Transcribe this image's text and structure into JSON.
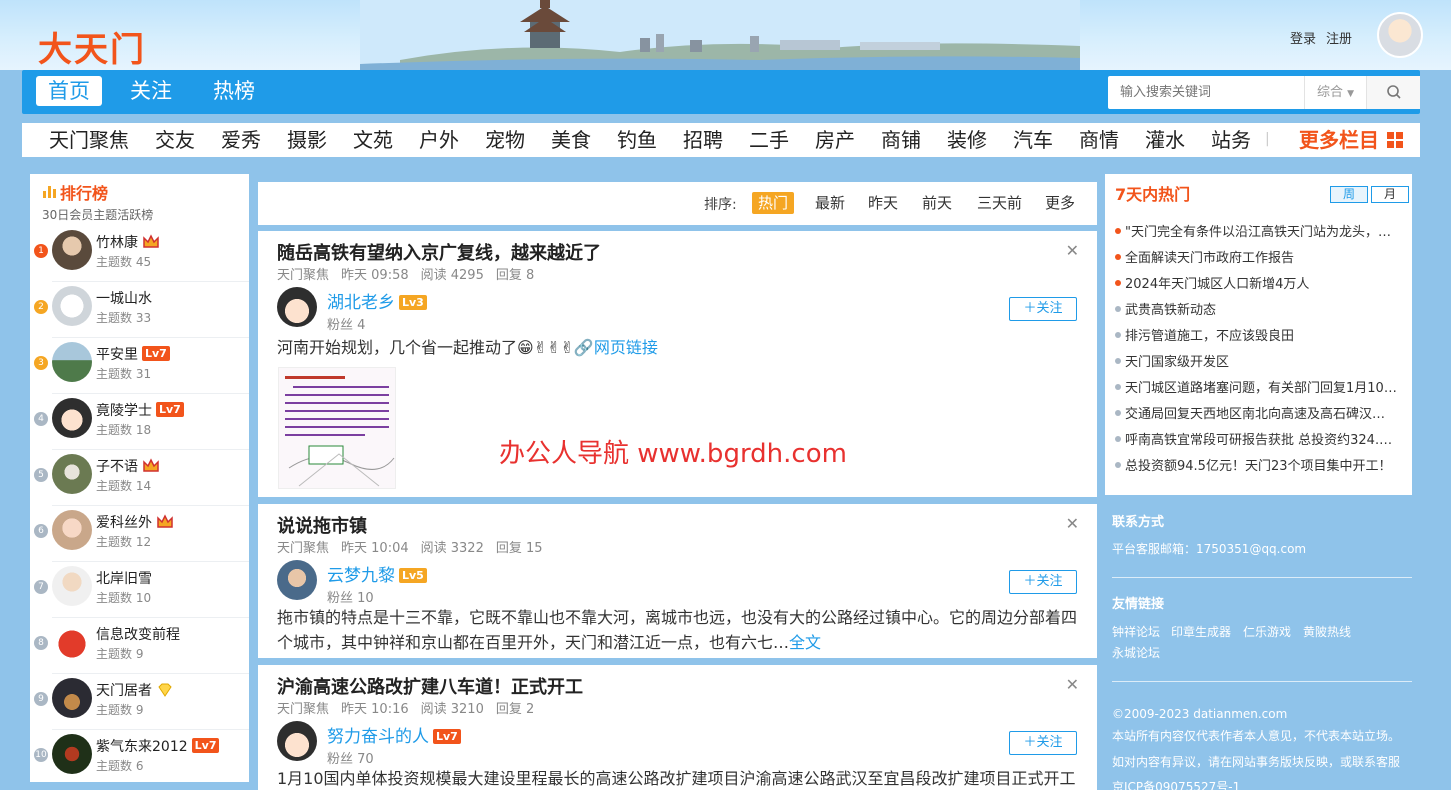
{
  "header": {
    "logo": "大天门",
    "login": "登录",
    "register": "注册"
  },
  "nav": {
    "items": [
      "首页",
      "关注",
      "热榜"
    ],
    "active_index": 0
  },
  "search": {
    "placeholder": "输入搜索关键词",
    "select": "综合"
  },
  "categories": [
    "天门聚焦",
    "交友",
    "爱秀",
    "摄影",
    "文苑",
    "户外",
    "宠物",
    "美食",
    "钓鱼",
    "招聘",
    "二手",
    "房产",
    "商铺",
    "装修",
    "汽车",
    "商情",
    "灌水",
    "站务"
  ],
  "more_label": "更多栏目",
  "ranking": {
    "title": "排行榜",
    "subtitle": "30日会员主题活跃榜",
    "count_label": "主题数",
    "items": [
      {
        "rank": "1",
        "name": "竹林康",
        "count": "45",
        "badge": "crown"
      },
      {
        "rank": "2",
        "name": "一城山水",
        "count": "33",
        "badge": ""
      },
      {
        "rank": "3",
        "name": "平安里",
        "count": "31",
        "badge": "Lv7"
      },
      {
        "rank": "4",
        "name": "竟陵学士",
        "count": "18",
        "badge": "Lv7"
      },
      {
        "rank": "5",
        "name": "子不语",
        "count": "14",
        "badge": "crown"
      },
      {
        "rank": "6",
        "name": "爱科丝外",
        "count": "12",
        "badge": "crown"
      },
      {
        "rank": "7",
        "name": "北岸旧雪",
        "count": "10",
        "badge": ""
      },
      {
        "rank": "8",
        "name": "信息改变前程",
        "count": "9",
        "badge": ""
      },
      {
        "rank": "9",
        "name": "天门居者",
        "count": "9",
        "badge": "diamond"
      },
      {
        "rank": "10",
        "name": "紫气东来2012",
        "count": "6",
        "badge": "Lv7"
      }
    ]
  },
  "sort": {
    "label": "排序:",
    "options": [
      "热门",
      "最新",
      "昨天",
      "前天",
      "三天前",
      "更多"
    ],
    "active_index": 0
  },
  "posts": [
    {
      "title": "随岳高铁有望纳入京广复线，越来越近了",
      "category": "天门聚焦",
      "time": "昨天 09:58",
      "reads": "阅读 4295",
      "replies": "回复 8",
      "author": "湖北老乡",
      "level": "Lv3",
      "fans": "粉丝 4",
      "follow": "关注",
      "body": "河南开始规划，几个省一起推动了",
      "link": "网页链接"
    },
    {
      "title": "说说拖市镇",
      "category": "天门聚焦",
      "time": "昨天 10:04",
      "reads": "阅读 3322",
      "replies": "回复 15",
      "author": "云梦九黎",
      "level": "Lv5",
      "fans": "粉丝 10",
      "follow": "关注",
      "body": "拖市镇的特点是十三不靠，它既不靠山也不靠大河，离城市也远，也没有大的公路经过镇中心。它的周边分部着四个城市，其中钟祥和京山都在百里开外，天门和潜江近一点，也有六七…",
      "link": "全文"
    },
    {
      "title": "沪渝高速公路改扩建八车道！正式开工",
      "category": "天门聚焦",
      "time": "昨天 10:16",
      "reads": "阅读 3210",
      "replies": "回复 2",
      "author": "努力奋斗的人",
      "level": "Lv7",
      "fans": "粉丝 70",
      "follow": "关注",
      "body": "1月10国内单体投资规模最大建设里程最长的高速公路改扩建项目沪渝高速公路武汉至宜昌段改扩建项目正式开工",
      "link": ""
    }
  ],
  "watermark": "办公人导航 www.bgrdh.com",
  "hot": {
    "title": "7天内热门",
    "tabs": [
      "周",
      "月"
    ],
    "items": [
      "\"天门完全有条件以沿江高铁天门站为龙头，…",
      "全面解读天门市政府工作报告",
      "2024年天门城区人口新增4万人",
      "武贵高铁新动态",
      "排污管道施工，不应该毁良田",
      "天门国家级开发区",
      "天门城区道路堵塞问题，有关部门回复1月10…",
      "交通局回复天西地区南北向高速及高石碑汉…",
      "呼南高铁宜常段可研报告获批 总投资约324.…",
      "总投资额94.5亿元！天门23个项目集中开工！"
    ]
  },
  "contact": {
    "title": "联系方式",
    "email": "平台客服邮箱：1750351@qq.com"
  },
  "friends": {
    "title": "友情链接",
    "links": [
      "钟祥论坛",
      "印章生成器",
      "仁乐游戏",
      "黄陂热线",
      "永城论坛"
    ]
  },
  "footer": {
    "copyright": "©2009-2023 datianmen.com",
    "line1": "本站所有内容仅代表作者本人意见，不代表本站立场。",
    "line2": "如对内容有异议，请在网站事务版块反映，或联系客服",
    "icp": "京ICP备09075527号-1"
  },
  "colors": {
    "accent": "#1f9be8",
    "brand_orange": "#f2541b",
    "hot_orange": "#f5a623",
    "background": "#8fc3ea"
  }
}
